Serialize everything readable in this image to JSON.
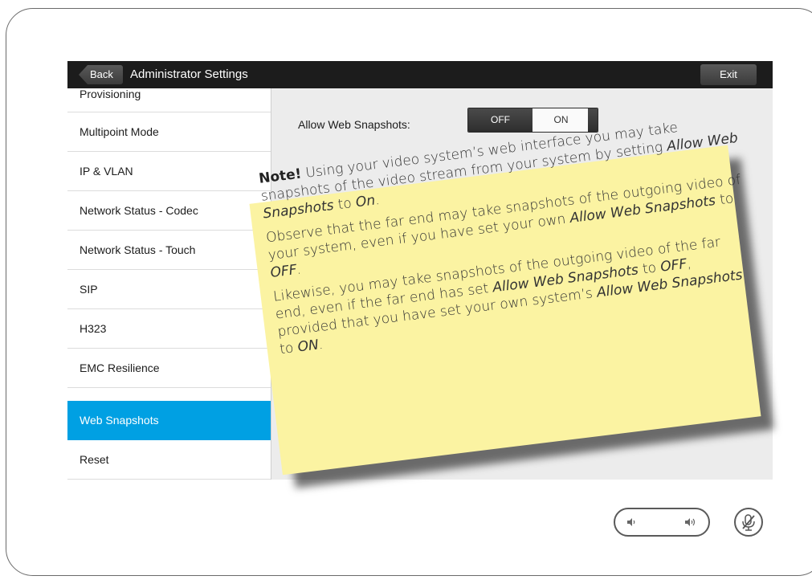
{
  "header": {
    "back_label": "Back",
    "title": "Administrator Settings",
    "exit_label": "Exit"
  },
  "sidebar": {
    "items": [
      {
        "label": "Provisioning",
        "active": false
      },
      {
        "label": "Multipoint Mode",
        "active": false
      },
      {
        "label": "IP & VLAN",
        "active": false
      },
      {
        "label": "Network Status - Codec",
        "active": false
      },
      {
        "label": "Network Status - Touch",
        "active": false
      },
      {
        "label": "SIP",
        "active": false
      },
      {
        "label": "H323",
        "active": false
      },
      {
        "label": "EMC Resilience",
        "active": false
      },
      {
        "label": "Web Snapshots",
        "active": true
      },
      {
        "label": "Reset",
        "active": false
      }
    ]
  },
  "main": {
    "setting_label": "Allow Web Snapshots:",
    "toggle": {
      "off_label": "OFF",
      "on_label": "ON",
      "selected": "OFF"
    }
  },
  "note": {
    "heading": "Note!",
    "p1_a": "Using your video system’s web interface you may take snapshots of the video stream from your system by setting",
    "p1_em": "Allow Web Snapshots",
    "p1_b": "to",
    "p1_em2": "On",
    "p1_c": ".",
    "p2_a": "Observe that the far end may take snapshots of the outgoing video of your system, even if you have set your own",
    "p2_em": "Allow Web Snapshots",
    "p2_b": "to",
    "p2_em2": "OFF",
    "p2_c": ".",
    "p3_a": "Likewise, you may take snapshots of the outgoing video of the far end, even if the far end has set",
    "p3_em": "Allow Web Snapshots",
    "p3_b": "to",
    "p3_em2": "OFF",
    "p3_c": ", provided that you have set your own system’s",
    "p3_em3": "Allow Web Snapshots",
    "p3_d": "to",
    "p3_em4": "ON",
    "p3_e": "."
  },
  "controls": {
    "volume_down_icon": "volume-down-icon",
    "volume_up_icon": "volume-up-icon",
    "mute_icon": "microphone-muted-icon"
  }
}
